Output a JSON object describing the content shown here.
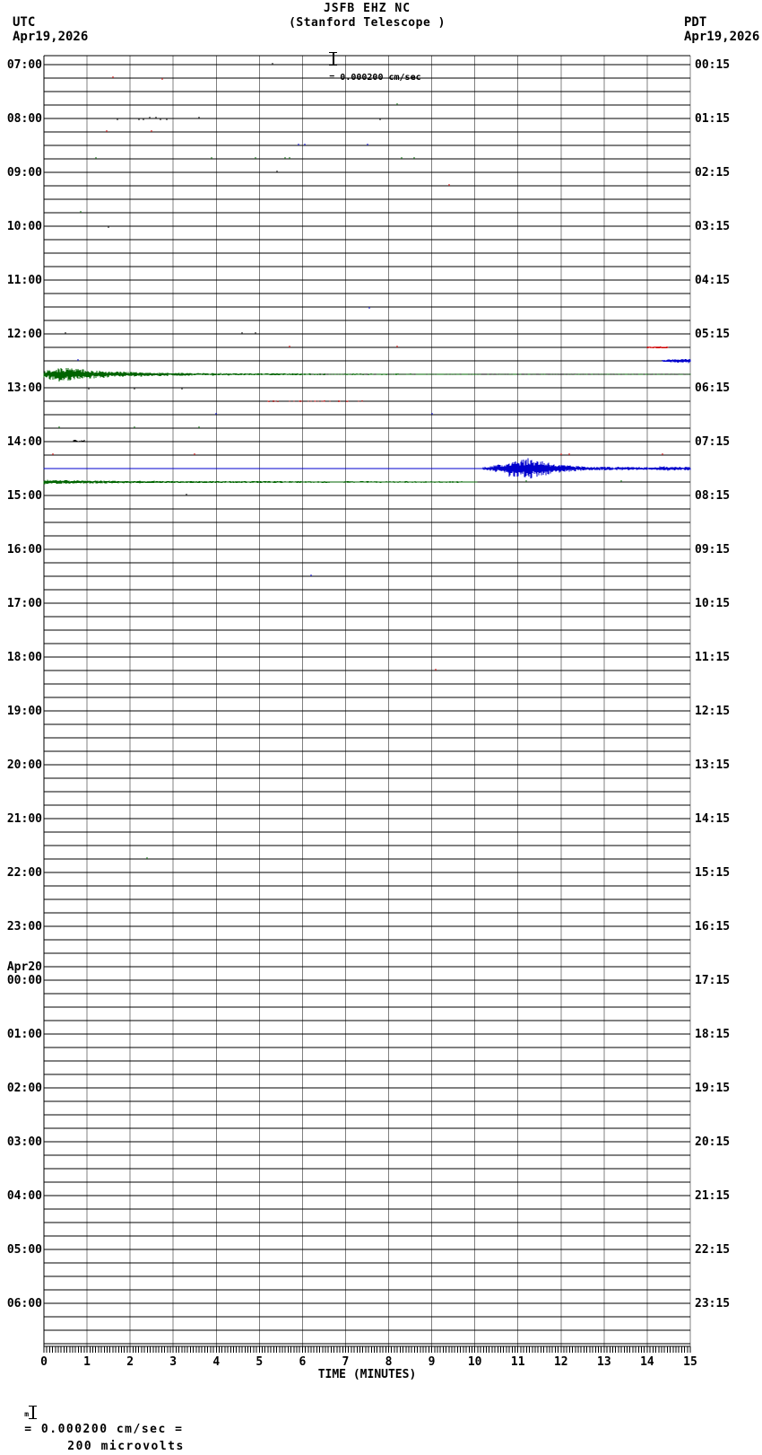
{
  "header": {
    "title": "JSFB EHZ NC",
    "subtitle": "(Stanford Telescope )",
    "scale_label": "= 0.000200 cm/sec",
    "left_timezone": "UTC",
    "left_date": "Apr19,2026",
    "right_timezone": "PDT",
    "right_date": "Apr19,2026"
  },
  "footer": {
    "axis_title": "TIME (MINUTES)",
    "note_prefix": "m",
    "note_scale": "= 0.000200 cm/sec =",
    "note_value": "200 microvolts"
  },
  "chart_data": {
    "type": "line",
    "kind": "helicorder-seismogram",
    "station": "JSFB",
    "channel": "EHZ",
    "network": "NC",
    "station_description": "Stanford Telescope",
    "scale_cm_per_sec": 0.0002,
    "scale_microvolts": 200,
    "utc_start_date": "Apr19,2026",
    "local_start_date": "Apr19,2026",
    "minutes_per_line": 15,
    "lines_per_hour": 4,
    "x_axis": {
      "label": "TIME (MINUTES)",
      "ticks": [
        0,
        1,
        2,
        3,
        4,
        5,
        6,
        7,
        8,
        9,
        10,
        11,
        12,
        13,
        14,
        15
      ],
      "range": [
        0,
        15
      ]
    },
    "utc_hour_labels": [
      "07:00",
      "08:00",
      "09:00",
      "10:00",
      "11:00",
      "12:00",
      "13:00",
      "14:00",
      "15:00",
      "16:00",
      "17:00",
      "18:00",
      "19:00",
      "20:00",
      "21:00",
      "22:00",
      "23:00",
      "00:00",
      "01:00",
      "02:00",
      "03:00",
      "04:00",
      "05:00",
      "06:00"
    ],
    "pdt_hour_labels": [
      "00:15",
      "01:15",
      "02:15",
      "03:15",
      "04:15",
      "05:15",
      "06:15",
      "07:15",
      "08:15",
      "09:15",
      "10:15",
      "11:15",
      "12:15",
      "13:15",
      "14:15",
      "15:15",
      "16:15",
      "17:15",
      "18:15",
      "19:15",
      "20:15",
      "21:15",
      "22:15",
      "23:15"
    ],
    "date_change": {
      "label": "Apr20",
      "at_utc_row": "00:00"
    },
    "trace_color_cycle": [
      "black",
      "red",
      "blue",
      "green"
    ],
    "colors": {
      "black": "#000000",
      "red": "#cc0000",
      "blue": "#0000cc",
      "green": "#006400",
      "grid": "#808080",
      "frame": "#000000"
    },
    "baseline_color_spans": [
      {
        "row": "14:30",
        "m0": 0,
        "m1": 15
      },
      {
        "row": "14:45",
        "m0": 0,
        "m1": 10.05
      }
    ],
    "events": [
      {
        "row": "12:15",
        "m0": 14.0,
        "m1": 14.5,
        "a0": 1.2,
        "a1": 1.2
      },
      {
        "row": "12:30",
        "m0": 14.35,
        "m1": 15,
        "a0": 1.5,
        "a1": 2.5
      },
      {
        "row": "12:45",
        "m0": 0,
        "m1": 0.3,
        "a0": 4,
        "a1": 8
      },
      {
        "row": "12:45",
        "m0": 0.3,
        "m1": 0.9,
        "a0": 8,
        "a1": 6
      },
      {
        "row": "12:45",
        "m0": 0.9,
        "m1": 1.4,
        "a0": 6,
        "a1": 4
      },
      {
        "row": "12:45",
        "m0": 1.4,
        "m1": 2.3,
        "a0": 3.5,
        "a1": 2.5
      },
      {
        "row": "12:45",
        "m0": 2.3,
        "m1": 3.5,
        "a0": 2.2,
        "a1": 1.5
      },
      {
        "row": "12:45",
        "m0": 3.5,
        "m1": 6,
        "a0": 1.4,
        "a1": 1
      },
      {
        "row": "12:45",
        "m0": 6,
        "m1": 10,
        "a0": 0.9,
        "a1": 0.7,
        "density": 0.8
      },
      {
        "row": "12:45",
        "m0": 10,
        "m1": 15,
        "a0": 0.7,
        "a1": 0.5,
        "density": 0.5
      },
      {
        "row": "13:15",
        "m0": 5.2,
        "m1": 7.4,
        "a0": 1,
        "a1": 0.8,
        "density": 0.3
      },
      {
        "row": "14:00",
        "m0": 0.68,
        "m1": 0.95,
        "a0": 2,
        "a1": 2,
        "side": "up"
      },
      {
        "row": "14:30",
        "m0": 0,
        "m1": 10.2,
        "a0": 0.6,
        "a1": 0.6
      },
      {
        "row": "14:30",
        "m0": 10.2,
        "m1": 10.75,
        "a0": 2,
        "a1": 6
      },
      {
        "row": "14:30",
        "m0": 10.75,
        "m1": 11.3,
        "a0": 9,
        "a1": 12
      },
      {
        "row": "14:30",
        "m0": 11.3,
        "m1": 11.8,
        "a0": 11,
        "a1": 7
      },
      {
        "row": "14:30",
        "m0": 11.8,
        "m1": 12.4,
        "a0": 5,
        "a1": 3
      },
      {
        "row": "14:30",
        "m0": 12.4,
        "m1": 13.2,
        "a0": 2.5,
        "a1": 2
      },
      {
        "row": "14:30",
        "m0": 13.2,
        "m1": 14.2,
        "a0": 1.8,
        "a1": 1.8
      },
      {
        "row": "14:30",
        "m0": 14.2,
        "m1": 15,
        "a0": 2.5,
        "a1": 2
      },
      {
        "row": "14:45",
        "m0": 0,
        "m1": 0.5,
        "a0": 2.5,
        "a1": 2
      },
      {
        "row": "14:45",
        "m0": 0.5,
        "m1": 2,
        "a0": 2,
        "a1": 1.4
      },
      {
        "row": "14:45",
        "m0": 2,
        "m1": 6,
        "a0": 1.3,
        "a1": 1
      },
      {
        "row": "14:45",
        "m0": 6,
        "m1": 10.05,
        "a0": 1,
        "a1": 0.8,
        "density": 0.85
      }
    ],
    "specks": [
      {
        "row": "07:00",
        "minutes": [
          5.3
        ]
      },
      {
        "row": "07:15",
        "minutes": [
          1.6,
          2.75
        ]
      },
      {
        "row": "07:45",
        "minutes": [
          8.2
        ]
      },
      {
        "row": "08:00",
        "minutes": [
          1.7,
          2.2,
          2.3,
          2.45,
          2.6,
          2.7,
          2.85,
          3.6,
          7.8
        ]
      },
      {
        "row": "08:15",
        "minutes": [
          1.45,
          2.5
        ]
      },
      {
        "row": "08:30",
        "minutes": [
          5.9,
          6.05,
          7.5
        ]
      },
      {
        "row": "08:45",
        "minutes": [
          1.2,
          3.9,
          4.9,
          5.6,
          5.7,
          8.3,
          8.6
        ]
      },
      {
        "row": "09:00",
        "minutes": [
          5.4
        ]
      },
      {
        "row": "09:15",
        "minutes": [
          9.4
        ]
      },
      {
        "row": "09:45",
        "minutes": [
          0.85
        ]
      },
      {
        "row": "10:00",
        "minutes": [
          1.5
        ]
      },
      {
        "row": "11:30",
        "minutes": [
          7.55
        ]
      },
      {
        "row": "12:00",
        "minutes": [
          0.5,
          4.6,
          4.9
        ]
      },
      {
        "row": "12:15",
        "minutes": [
          5.7,
          8.2
        ]
      },
      {
        "row": "12:30",
        "minutes": [
          0.8
        ]
      },
      {
        "row": "13:00",
        "minutes": [
          1.05,
          2.1,
          3.2
        ]
      },
      {
        "row": "13:30",
        "minutes": [
          4.0,
          9.0
        ]
      },
      {
        "row": "13:45",
        "minutes": [
          0.35,
          2.1,
          3.6
        ]
      },
      {
        "row": "14:15",
        "minutes": [
          0.2,
          3.5,
          12.0,
          12.2,
          14.35
        ]
      },
      {
        "row": "14:45",
        "minutes": [
          11.2,
          13.4
        ]
      },
      {
        "row": "15:00",
        "minutes": [
          3.3
        ]
      },
      {
        "row": "16:30",
        "minutes": [
          6.2
        ]
      },
      {
        "row": "18:15",
        "minutes": [
          9.1
        ]
      },
      {
        "row": "21:45",
        "minutes": [
          2.4
        ]
      }
    ]
  }
}
